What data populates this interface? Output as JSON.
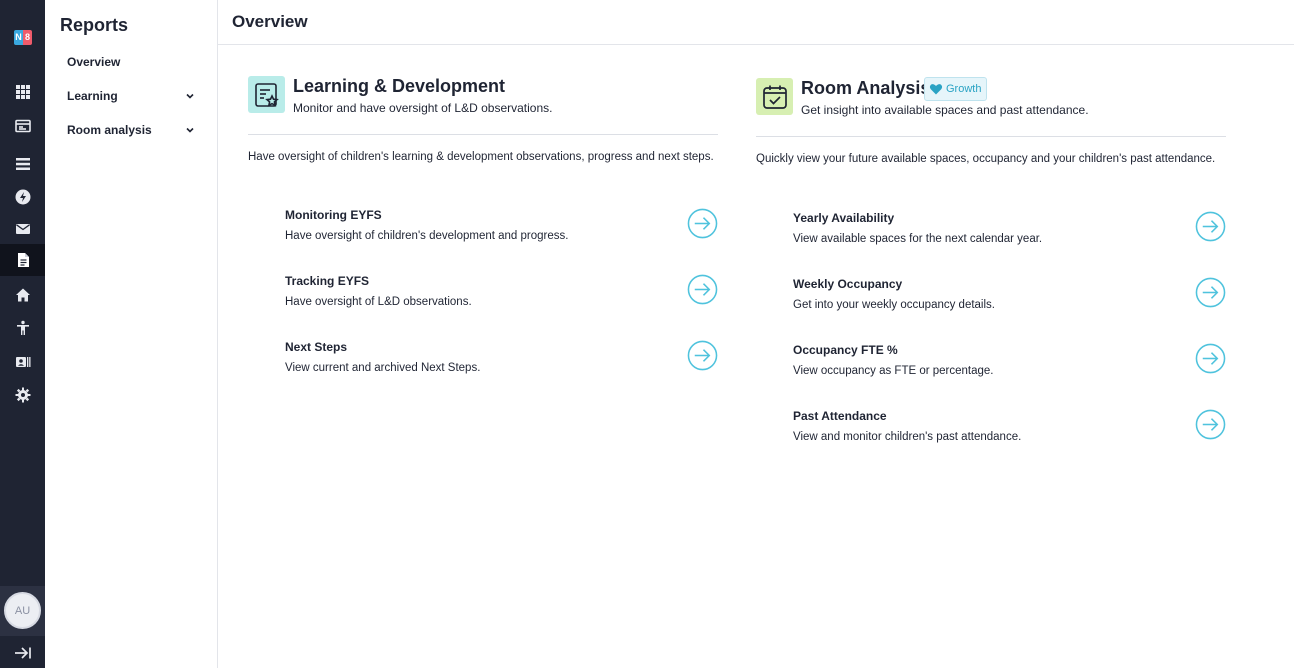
{
  "rail": {
    "logo": [
      "N",
      "8"
    ],
    "items": [
      {
        "icon": "grid-icon"
      },
      {
        "icon": "calendar-card-icon"
      },
      {
        "icon": "stacked-lines-icon"
      },
      {
        "icon": "bolt-icon"
      },
      {
        "icon": "mail-icon"
      },
      {
        "icon": "document-icon",
        "active": true
      },
      {
        "icon": "home-icon"
      },
      {
        "icon": "accessibility-icon"
      },
      {
        "icon": "id-card-icon"
      },
      {
        "icon": "gear-icon"
      }
    ],
    "avatar_initials": "AU",
    "collapse_icon": "collapse-arrow-icon"
  },
  "subnav": {
    "title": "Reports",
    "items": [
      {
        "label": "Overview"
      },
      {
        "label": "Learning"
      },
      {
        "label": "Room analysis"
      }
    ]
  },
  "header": {
    "title": "Overview"
  },
  "cards": [
    {
      "icon": "star-document-icon",
      "title": "Learning & Development",
      "subtitle": "Monitor and have oversight of L&D observations.",
      "description": "Have oversight of children's learning & development observations, progress and next steps.",
      "rows": [
        {
          "title": "Monitoring EYFS",
          "subtitle": "Have oversight of children's development and progress."
        },
        {
          "title": "Tracking EYFS",
          "subtitle": "Have oversight of L&D observations."
        },
        {
          "title": "Next Steps",
          "subtitle": "View current and archived Next Steps."
        }
      ]
    },
    {
      "icon": "calendar-check-icon",
      "title": "Room Analysis",
      "badge": "Growth",
      "subtitle": "Get insight into available spaces and past attendance.",
      "description": "Quickly view your future available spaces, occupancy and your children's past attendance.",
      "rows": [
        {
          "title": "Yearly Availability",
          "subtitle": "View available spaces for the next calendar year."
        },
        {
          "title": "Weekly Occupancy",
          "subtitle": "Get into your weekly occupancy details."
        },
        {
          "title": "Occupancy FTE %",
          "subtitle": "View occupancy as FTE or percentage."
        },
        {
          "title": "Past Attendance",
          "subtitle": "View and monitor children's past attendance."
        }
      ]
    }
  ],
  "colors": {
    "rail_bg": "#1f2433",
    "accent": "#4fc3dd",
    "ld_icon_bg": "#b9ece9",
    "room_icon_bg": "#d7efb2",
    "badge_text": "#2aa3c4"
  }
}
